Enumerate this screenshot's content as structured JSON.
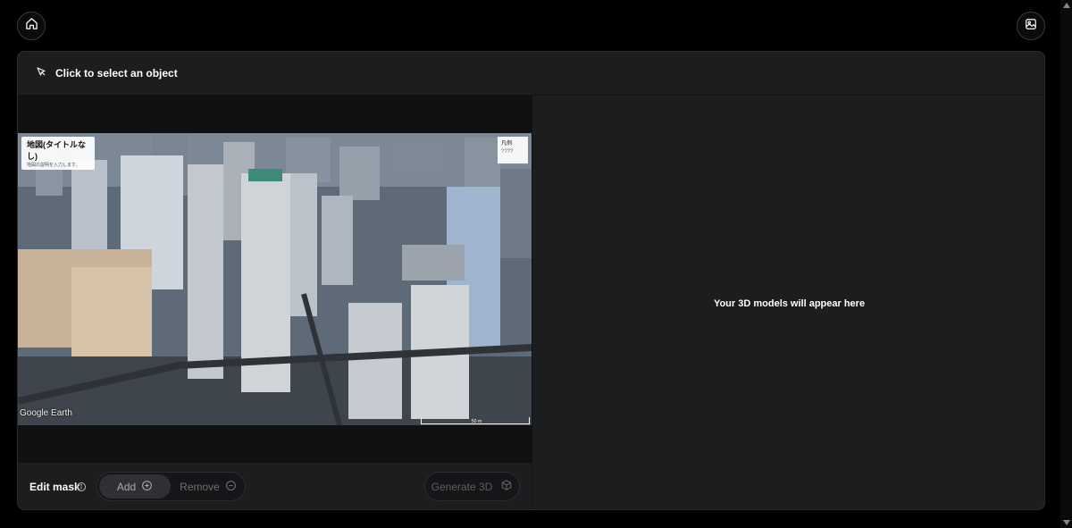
{
  "nav": {
    "home_icon": "home-icon",
    "gallery_icon": "image-gallery-icon"
  },
  "panel": {
    "header_hint": "Click to select an object",
    "header_icon": "pointer-select-icon"
  },
  "screenshot": {
    "map_title": "地図(タイトルなし)",
    "map_subtitle": "地図の説明を入力します。",
    "legend_title": "凡例",
    "legend_item": "????",
    "watermark": "Google Earth",
    "scale_label": "50 m"
  },
  "controls": {
    "edit_mask_label": "Edit mask",
    "add_label": "Add",
    "remove_label": "Remove",
    "generate_label": "Generate 3D"
  },
  "right_pane": {
    "placeholder": "Your 3D models will appear here"
  },
  "colors": {
    "background": "#000000",
    "panel": "#1c1d1f",
    "disabled_text": "#5e5f62"
  }
}
